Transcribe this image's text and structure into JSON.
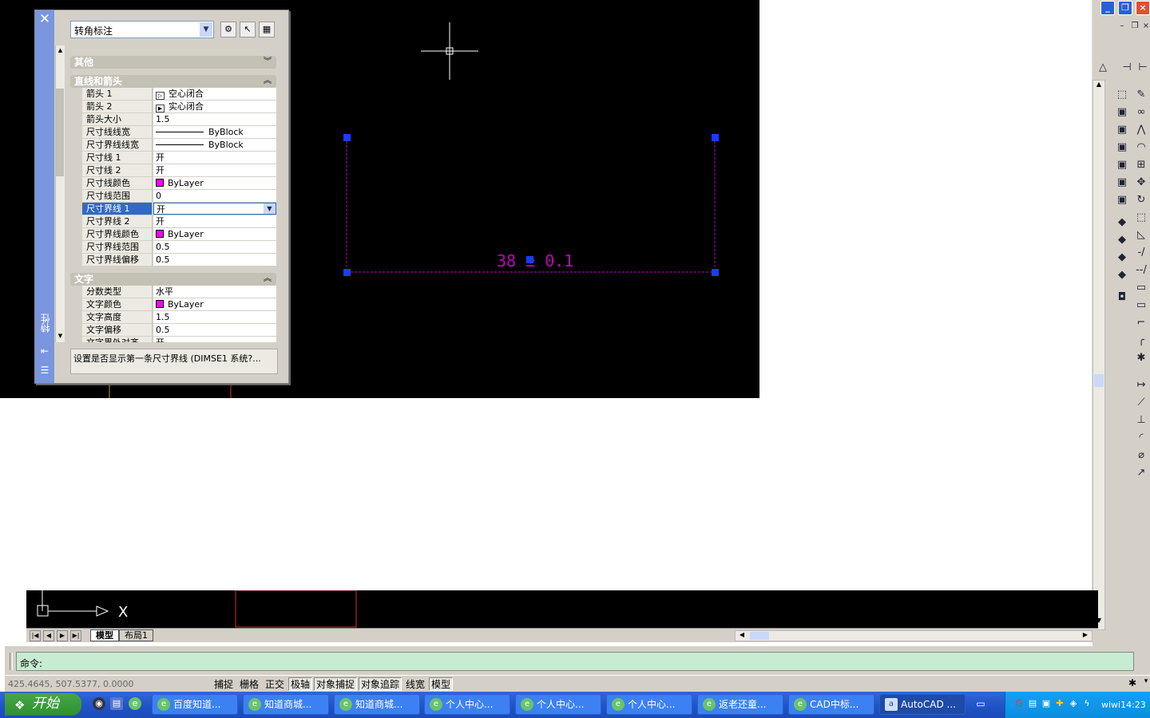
{
  "palette": {
    "title": "特性",
    "object_type": "转角标注",
    "categories": [
      {
        "label": "其他"
      },
      {
        "label": "直线和箭头"
      },
      {
        "label": "文字"
      }
    ],
    "lines_arrows_rows": [
      {
        "name": "箭头 1",
        "value": "空心闭合"
      },
      {
        "name": "箭头 2",
        "value": "实心闭合"
      },
      {
        "name": "箭头大小",
        "value": "1.5"
      },
      {
        "name": "尺寸线线宽",
        "value": "ByBlock"
      },
      {
        "name": "尺寸界线线宽",
        "value": "ByBlock"
      },
      {
        "name": "尺寸线 1",
        "value": "开"
      },
      {
        "name": "尺寸线 2",
        "value": "开"
      },
      {
        "name": "尺寸线颜色",
        "value": "ByLayer"
      },
      {
        "name": "尺寸线范围",
        "value": "0"
      },
      {
        "name": "尺寸界线 1",
        "value": "开"
      },
      {
        "name": "尺寸界线 2",
        "value": "开"
      },
      {
        "name": "尺寸界线颜色",
        "value": "ByLayer"
      },
      {
        "name": "尺寸界线范围",
        "value": "0.5"
      },
      {
        "name": "尺寸界线偏移",
        "value": "0.5"
      }
    ],
    "text_rows": [
      {
        "name": "分数类型",
        "value": "水平"
      },
      {
        "name": "文字颜色",
        "value": "ByLayer"
      },
      {
        "name": "文字高度",
        "value": "1.5"
      },
      {
        "name": "文字偏移",
        "value": "0.5"
      },
      {
        "name": "文字界外对齐",
        "value": "开"
      }
    ],
    "description": "设置是否显示第一条尺寸界线 (DIMSE1 系统?..."
  },
  "drawing": {
    "dimension_text": "38 ± 0.1",
    "dimension_color": "#c000c0",
    "grip_color": "#1a3cff"
  },
  "tabs": {
    "model": "模型",
    "layout1": "布局1"
  },
  "command": {
    "prompt": "命令:"
  },
  "status": {
    "coords": "425.4645, 507.5377, 0.0000",
    "buttons": [
      "捕捉",
      "栅格",
      "正交",
      "极轴",
      "对象捕捉",
      "对象追踪",
      "线宽",
      "模型"
    ]
  },
  "taskbar": {
    "start_label": "开始",
    "tasks": [
      {
        "label": "百度知道..."
      },
      {
        "label": "知道商城..."
      },
      {
        "label": "知道商城..."
      },
      {
        "label": "个人中心..."
      },
      {
        "label": "个人中心..."
      },
      {
        "label": "个人中心..."
      },
      {
        "label": "返老还童..."
      },
      {
        "label": "CAD中标..."
      },
      {
        "label": "AutoCAD ..."
      }
    ],
    "clock": "wiwi14:23"
  }
}
